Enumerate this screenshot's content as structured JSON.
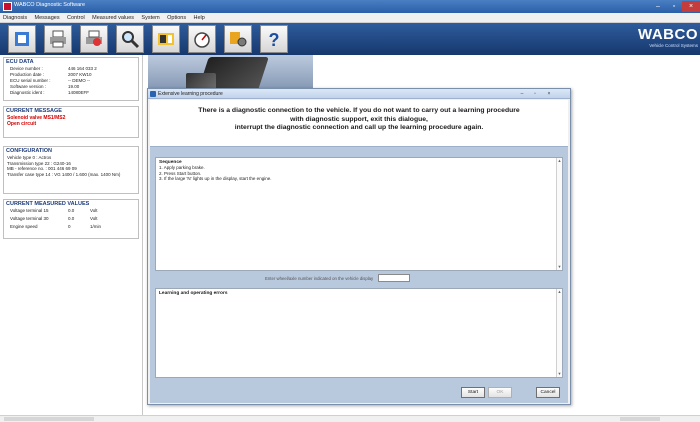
{
  "window": {
    "title": "WABCO Diagnostic Software"
  },
  "menu": [
    "Diagnosis",
    "Messages",
    "Control",
    "Measured values",
    "System",
    "Options",
    "Help"
  ],
  "brand": {
    "logo": "WABCO",
    "tagline": "Vehicle Control Systems"
  },
  "ecu_data": {
    "header": "ECU DATA",
    "rows": [
      {
        "label": "Device number :",
        "value": "446 164 033 2"
      },
      {
        "label": "Production date :",
        "value": "2007 KW10"
      },
      {
        "label": "ECU serial number :",
        "value": "-- DEMO --"
      },
      {
        "label": "Software version :",
        "value": "19.00"
      },
      {
        "label": "Diagnostic ident :",
        "value": "14080EFF"
      }
    ]
  },
  "current_message": {
    "header": "CURRENT MESSAGE",
    "line1": "Solenoid valve MS1/MS2",
    "line2": "Open circuit"
  },
  "configuration": {
    "header": "CONFIGURATION",
    "lines": [
      "Vehicle type 0 : Actros",
      "Transmission type 22 : G240-16",
      "MB - reference no. : 001 446 69 09",
      "Transfer case type 14 : VG 1400 / 1.600 (max. 1400 Nm)"
    ]
  },
  "measured_values": {
    "header": "CURRENT MEASURED VALUES",
    "rows": [
      {
        "label": "Voltage terminal 15",
        "value": "0.0",
        "unit": "Volt"
      },
      {
        "label": "Voltage terminal 30",
        "value": "0.0",
        "unit": "Volt"
      },
      {
        "label": "Engine speed",
        "value": "0",
        "unit": "1/min"
      }
    ]
  },
  "dialog": {
    "title": "Extensive learning procedure",
    "banner": [
      "There is a diagnostic connection to the vehicle. If you do not want to carry out a learning procedure",
      "with diagnostic support, exit this dialogue,",
      "interrupt the diagnostic connection and call up the learning procedure again."
    ],
    "sequence": {
      "header": "Sequence",
      "lines": [
        "1. Apply parking brake.",
        "2. Press Start button.",
        "3. If the large 'N' lights up in the display, start the engine."
      ]
    },
    "wheel_label": "Enter wheel/axle number indicated on the vehicle display",
    "wheel_value": "",
    "errors_header": "Learning and operating errors",
    "buttons": {
      "start": "Start",
      "ok": "OK",
      "cancel": "Cancel"
    }
  },
  "icons": [
    "ecu-icon",
    "print-icon",
    "print-preview-icon",
    "search-icon",
    "measure-icon",
    "gauge-icon",
    "config-icon",
    "help-icon"
  ],
  "colors": {
    "toolbar": "#1e4683",
    "message": "#d00000",
    "dialog_body": "#b8c8dd"
  }
}
